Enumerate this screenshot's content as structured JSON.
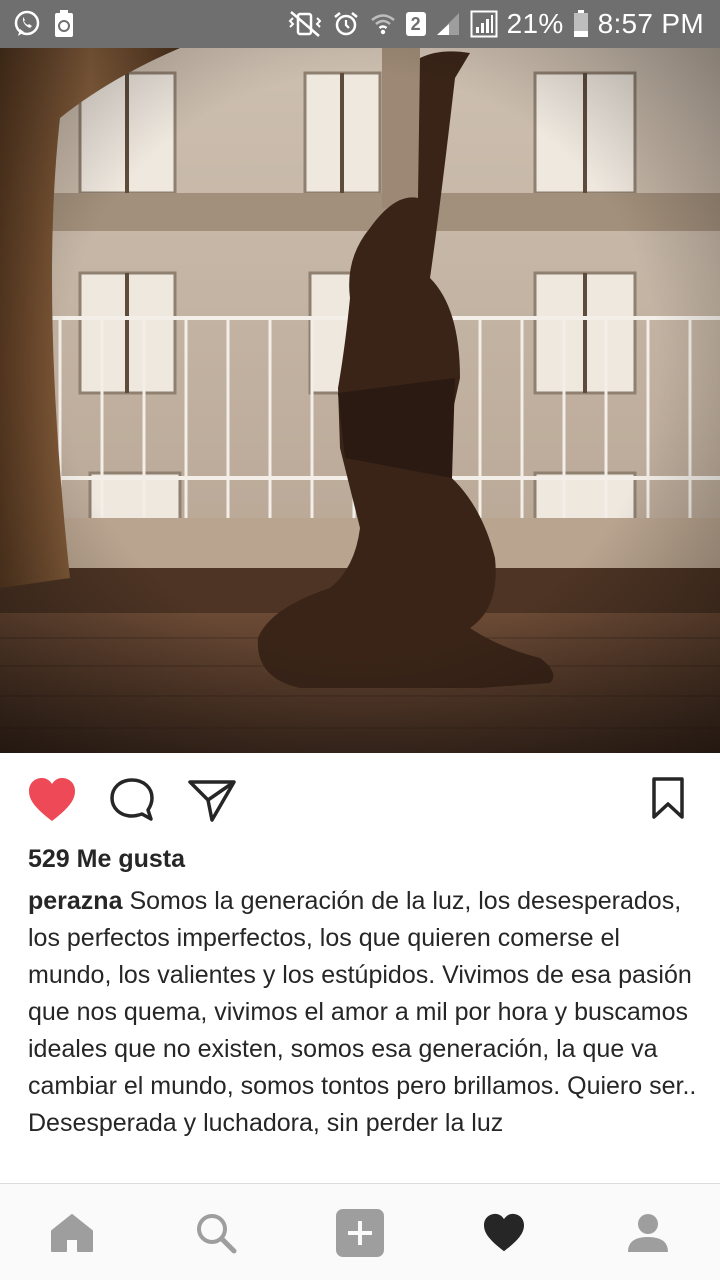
{
  "status_bar": {
    "battery_percent": "21%",
    "time": "8:57 PM",
    "sim_slot": "2",
    "icons": [
      "whatsapp-icon",
      "recycle-icon",
      "vibrate-icon",
      "alarm-icon",
      "wifi-icon",
      "signal-icon",
      "signal-boxed-icon",
      "battery-icon"
    ]
  },
  "post": {
    "image_alt": "photo",
    "liked": true,
    "likes_text": "529 Me gusta",
    "username": "perazna",
    "caption": "Somos la generación de la luz, los desesperados, los perfectos imperfectos, los que quieren comerse el mundo, los valientes y los estúpidos. Vivimos de esa pasión que nos quema, vivimos el amor a mil por hora y buscamos ideales que no existen, somos esa generación, la que va cambiar el mundo, somos tontos pero brillamos. Quiero ser.. Desesperada y luchadora, sin perder la luz"
  },
  "actions": {
    "icons": [
      "heart-icon",
      "comment-icon",
      "share-icon",
      "bookmark-icon"
    ],
    "like_color": "#ed4956"
  },
  "bottom_nav": {
    "items": [
      "home-icon",
      "search-icon",
      "add-post-icon",
      "activity-heart-icon",
      "profile-icon"
    ],
    "active": "activity-heart-icon"
  }
}
